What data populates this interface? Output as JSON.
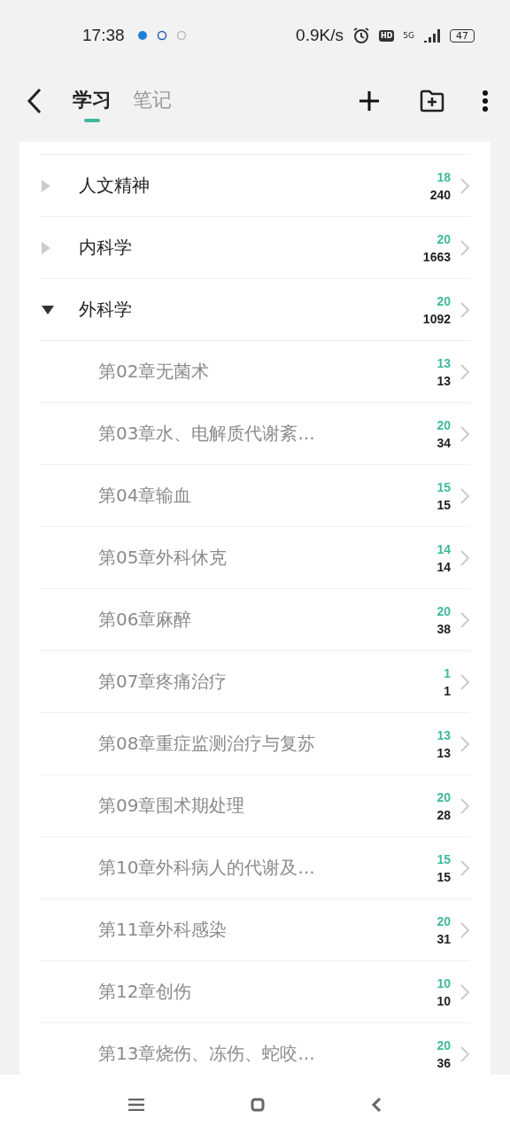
{
  "status_bar": {
    "time": "17:38",
    "speed": "0.9K/s",
    "hd": "HD",
    "network": "5G",
    "battery": "47"
  },
  "header": {
    "tabs": [
      {
        "label": "学习",
        "selected": true
      },
      {
        "label": "笔记",
        "selected": false
      }
    ]
  },
  "tree": [
    {
      "title": "人文精神",
      "due": "18",
      "total": "240",
      "expanded": false
    },
    {
      "title": "内科学",
      "due": "20",
      "total": "1663",
      "expanded": false
    },
    {
      "title": "外科学",
      "due": "20",
      "total": "1092",
      "expanded": true,
      "children": [
        {
          "title": "第02章无菌术",
          "due": "13",
          "total": "13"
        },
        {
          "title": "第03章水、电解质代谢紊...",
          "due": "20",
          "total": "34"
        },
        {
          "title": "第04章输血",
          "due": "15",
          "total": "15"
        },
        {
          "title": "第05章外科休克",
          "due": "14",
          "total": "14"
        },
        {
          "title": "第06章麻醉",
          "due": "20",
          "total": "38"
        },
        {
          "title": "第07章疼痛治疗",
          "due": "1",
          "total": "1"
        },
        {
          "title": "第08章重症监测治疗与复苏",
          "due": "13",
          "total": "13"
        },
        {
          "title": "第09章围术期处理",
          "due": "20",
          "total": "28"
        },
        {
          "title": "第10章外科病人的代谢及...",
          "due": "15",
          "total": "15"
        },
        {
          "title": "第11章外科感染",
          "due": "20",
          "total": "31"
        },
        {
          "title": "第12章创伤",
          "due": "10",
          "total": "10"
        },
        {
          "title": "第13章烧伤、冻伤、蛇咬...",
          "due": "20",
          "total": "36"
        }
      ]
    }
  ]
}
